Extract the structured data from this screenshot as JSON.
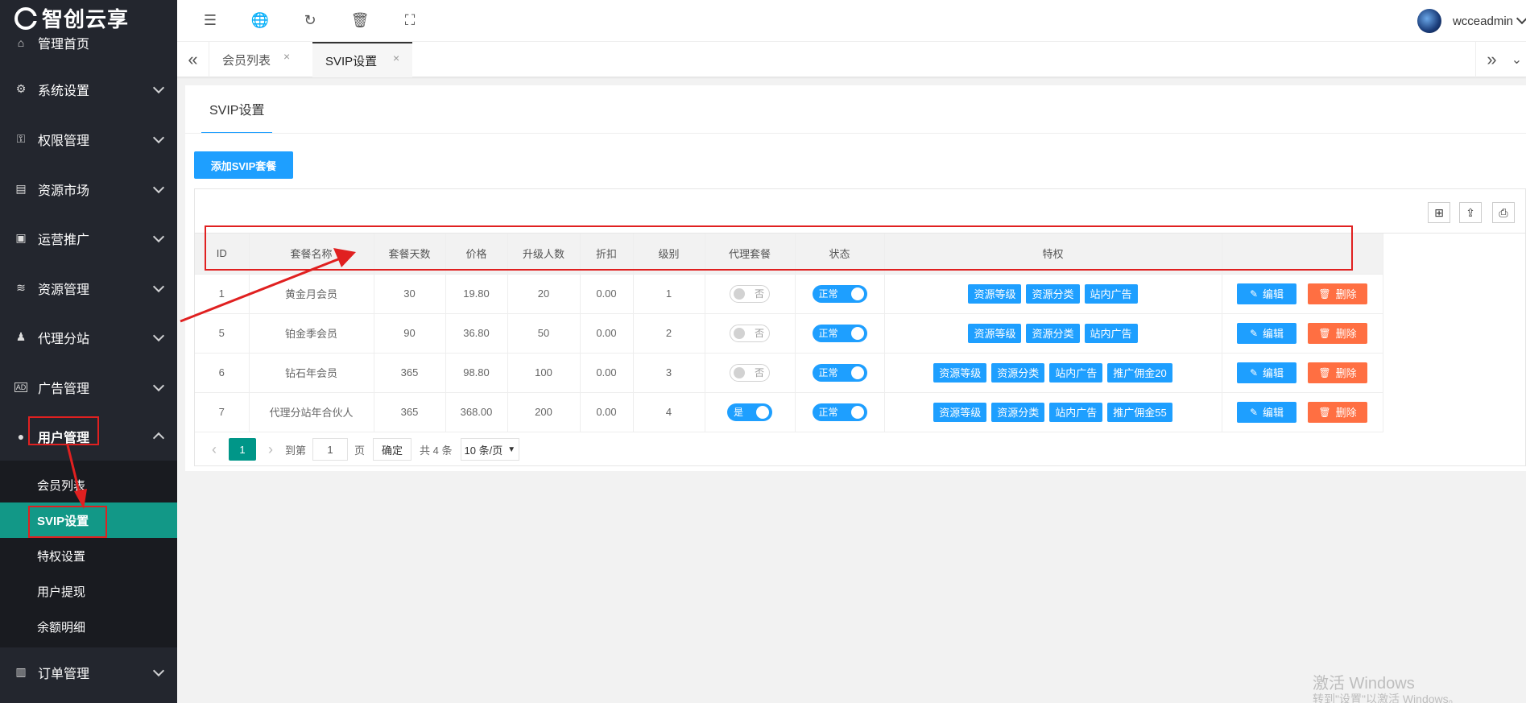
{
  "logo": {
    "text": "智创云享"
  },
  "sidebar": {
    "cropped_item": "管理首页",
    "items": [
      {
        "label": "系统设置",
        "icon": "gear-icon"
      },
      {
        "label": "权限管理",
        "icon": "key-icon"
      },
      {
        "label": "资源市场",
        "icon": "store-icon"
      },
      {
        "label": "运营推广",
        "icon": "megaphone-icon"
      },
      {
        "label": "资源管理",
        "icon": "layers-icon"
      },
      {
        "label": "代理分站",
        "icon": "group-icon"
      },
      {
        "label": "广告管理",
        "icon": "ad-icon"
      },
      {
        "label": "用户管理",
        "icon": "user-icon"
      },
      {
        "label": "订单管理",
        "icon": "clipboard-icon"
      }
    ],
    "submenu": [
      "会员列表",
      "SVIP设置",
      "特权设置",
      "用户提现",
      "余额明细"
    ],
    "active_submenu": "SVIP设置"
  },
  "header": {
    "username": "wcceadmin"
  },
  "tabs": [
    {
      "label": "会员列表",
      "close": "×"
    },
    {
      "label": "SVIP设置",
      "close": "×"
    }
  ],
  "card": {
    "tab_title": "SVIP设置",
    "add_button": "添加SVIP套餐"
  },
  "table": {
    "columns": [
      "ID",
      "套餐名称",
      "套餐天数",
      "价格",
      "升级人数",
      "折扣",
      "级别",
      "代理套餐",
      "状态",
      "特权",
      ""
    ],
    "rows": [
      {
        "id": "1",
        "name": "黄金月会员",
        "days": "30",
        "price": "19.80",
        "upgrade": "20",
        "discount": "0.00",
        "level": "1",
        "agent": "否",
        "status": "正常",
        "privileges": [
          "资源等级",
          "资源分类",
          "站内广告"
        ]
      },
      {
        "id": "5",
        "name": "铂金季会员",
        "days": "90",
        "price": "36.80",
        "upgrade": "50",
        "discount": "0.00",
        "level": "2",
        "agent": "否",
        "status": "正常",
        "privileges": [
          "资源等级",
          "资源分类",
          "站内广告"
        ]
      },
      {
        "id": "6",
        "name": "钻石年会员",
        "days": "365",
        "price": "98.80",
        "upgrade": "100",
        "discount": "0.00",
        "level": "3",
        "agent": "否",
        "status": "正常",
        "privileges": [
          "资源等级",
          "资源分类",
          "站内广告",
          "推广佣金20"
        ]
      },
      {
        "id": "7",
        "name": "代理分站年合伙人",
        "days": "365",
        "price": "368.00",
        "upgrade": "200",
        "discount": "0.00",
        "level": "4",
        "agent": "是",
        "status": "正常",
        "privileges": [
          "资源等级",
          "资源分类",
          "站内广告",
          "推广佣金55"
        ]
      }
    ],
    "actions": {
      "edit": "编辑",
      "delete": "删除"
    }
  },
  "pager": {
    "current": "1",
    "goto_label": "到第",
    "goto_value": "1",
    "page_unit": "页",
    "ok": "确定",
    "total": "共 4 条",
    "page_size": "10 条/页"
  },
  "watermark": {
    "line1": "激活 Windows",
    "line2": "转到\"设置\"以激活 Windows。"
  },
  "colors": {
    "sidebar_bg": "#23262e",
    "active_green": "#129887",
    "primary_blue": "#1e9fff",
    "danger": "#ff5722",
    "annotation_red": "#e02020"
  }
}
